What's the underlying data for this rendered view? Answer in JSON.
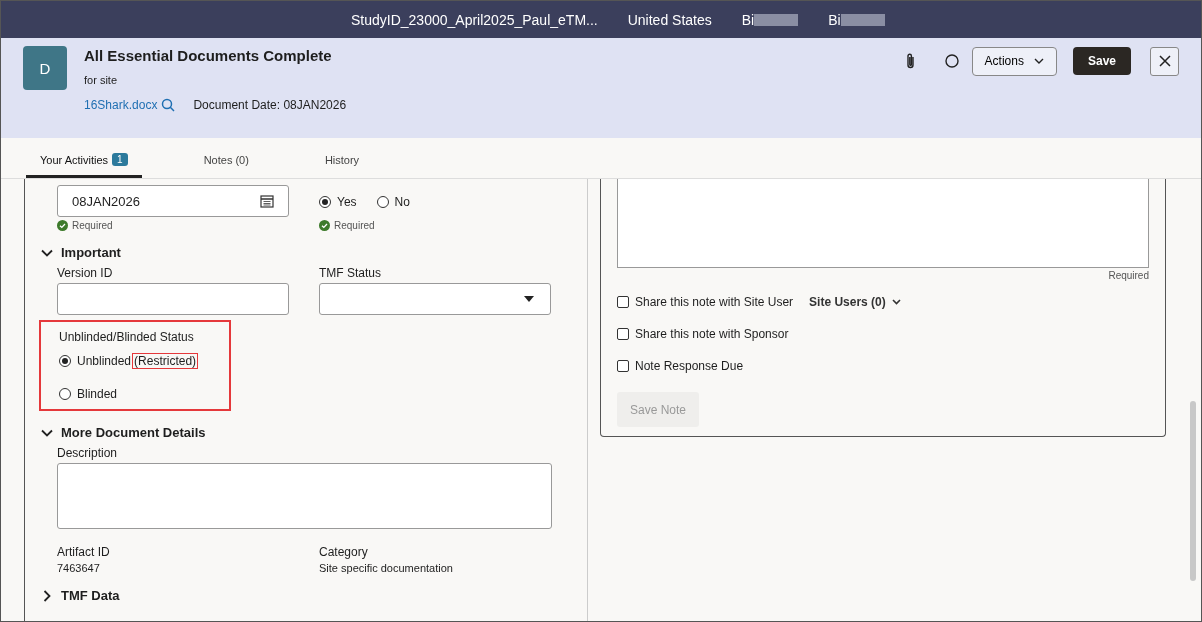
{
  "top_bar": {
    "study": "StudyID_23000_April2025_Paul_eTM...",
    "country": "United States",
    "users": [
      "Bi",
      "Bi"
    ]
  },
  "header": {
    "avatar": "D",
    "title": "All Essential Documents Complete",
    "subtitle": "for site",
    "file_link": "16Shark.docx",
    "document_date": "Document Date: 08JAN2026",
    "actions_label": "Actions",
    "save_label": "Save"
  },
  "tabs": [
    {
      "label": "Your Activities",
      "badge": "1",
      "selected": true
    },
    {
      "label": "Notes (0)",
      "selected": false
    },
    {
      "label": "History",
      "selected": false
    }
  ],
  "form": {
    "document_date": {
      "value": "08JAN2026",
      "hint": "Required"
    },
    "wet_ink": {
      "options": [
        {
          "label": "Yes",
          "selected": true
        },
        {
          "label": "No",
          "selected": false
        }
      ],
      "hint": "Required"
    },
    "important": {
      "title": "Important",
      "expanded": true,
      "version_id": {
        "label": "Version ID"
      },
      "tmf_status": {
        "label": "TMF Status"
      },
      "blind_status": {
        "label": "Unblinded/Blinded Status",
        "highlighted": true,
        "options": [
          {
            "label": "Unblinded",
            "note": "(Restricted)",
            "note_highlighted": true,
            "selected": true
          },
          {
            "label": "Blinded",
            "selected": false
          }
        ]
      }
    },
    "details": {
      "title": "More Document Details",
      "expanded": true,
      "description": {
        "label": "Description"
      },
      "artifact": {
        "label": "Artifact ID",
        "value": "7463647"
      },
      "category": {
        "label": "Category",
        "value": "Site specific documentation"
      }
    },
    "tmf_data": {
      "title": "TMF Data",
      "expanded": false
    }
  },
  "note": {
    "hint": "Required",
    "options": [
      {
        "label": "Share this note with Site User",
        "checked": false
      },
      {
        "label": "Share this note with Sponsor",
        "checked": false
      },
      {
        "label": "Note Response Due",
        "checked": false
      }
    ],
    "site_users": "Site Users (0)",
    "save_label": "Save Note",
    "save_disabled": true
  }
}
